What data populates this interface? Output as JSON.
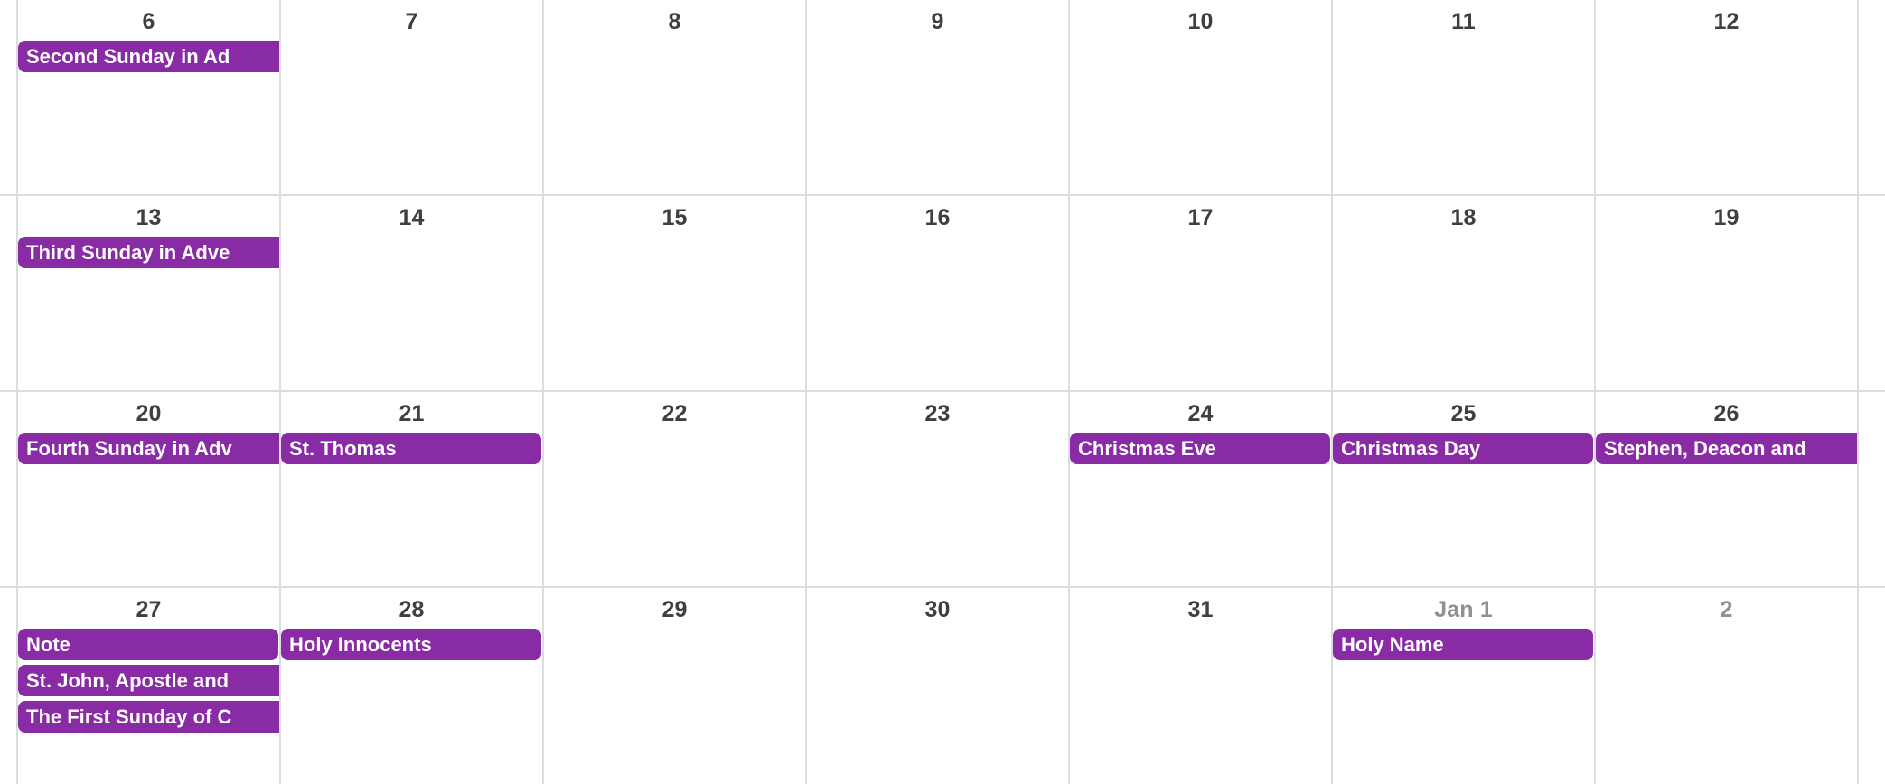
{
  "calendar": {
    "view": "month-grid",
    "accent_color": "#8a2ba6",
    "grid_line_color": "#dadce0",
    "day_number_color": "#3c4043",
    "other_month_day_number_color": "#8d9196",
    "weeks": [
      {
        "days": [
          {
            "number": "6",
            "other_month": false,
            "events": [
              {
                "title": "Second Sunday in Ad",
                "full_title": "Second Sunday in Ad",
                "clipped": true
              }
            ]
          },
          {
            "number": "7",
            "other_month": false,
            "events": []
          },
          {
            "number": "8",
            "other_month": false,
            "events": []
          },
          {
            "number": "9",
            "other_month": false,
            "events": []
          },
          {
            "number": "10",
            "other_month": false,
            "events": []
          },
          {
            "number": "11",
            "other_month": false,
            "events": []
          },
          {
            "number": "12",
            "other_month": false,
            "events": []
          }
        ]
      },
      {
        "days": [
          {
            "number": "13",
            "other_month": false,
            "events": [
              {
                "title": "Third Sunday in Adve",
                "full_title": "Third Sunday in Adve",
                "clipped": true
              }
            ]
          },
          {
            "number": "14",
            "other_month": false,
            "events": []
          },
          {
            "number": "15",
            "other_month": false,
            "events": []
          },
          {
            "number": "16",
            "other_month": false,
            "events": []
          },
          {
            "number": "17",
            "other_month": false,
            "events": []
          },
          {
            "number": "18",
            "other_month": false,
            "events": []
          },
          {
            "number": "19",
            "other_month": false,
            "events": []
          }
        ]
      },
      {
        "days": [
          {
            "number": "20",
            "other_month": false,
            "events": [
              {
                "title": "Fourth Sunday in Adv",
                "full_title": "Fourth Sunday in Adv",
                "clipped": true
              }
            ]
          },
          {
            "number": "21",
            "other_month": false,
            "events": [
              {
                "title": "St. Thomas",
                "full_title": "St. Thomas",
                "clipped": false
              }
            ]
          },
          {
            "number": "22",
            "other_month": false,
            "events": []
          },
          {
            "number": "23",
            "other_month": false,
            "events": []
          },
          {
            "number": "24",
            "other_month": false,
            "events": [
              {
                "title": "Christmas Eve",
                "full_title": "Christmas Eve",
                "clipped": false
              }
            ]
          },
          {
            "number": "25",
            "other_month": false,
            "events": [
              {
                "title": "Christmas Day",
                "full_title": "Christmas Day",
                "clipped": false
              }
            ]
          },
          {
            "number": "26",
            "other_month": false,
            "events": [
              {
                "title": "Stephen, Deacon and",
                "full_title": "Stephen, Deacon and",
                "clipped": true
              }
            ]
          }
        ]
      },
      {
        "days": [
          {
            "number": "27",
            "other_month": false,
            "events": [
              {
                "title": "Note",
                "full_title": "Note",
                "clipped": false
              },
              {
                "title": "St. John, Apostle and",
                "full_title": "St. John, Apostle and",
                "clipped": true
              },
              {
                "title": "The First Sunday of C",
                "full_title": "The First Sunday of C",
                "clipped": true
              }
            ]
          },
          {
            "number": "28",
            "other_month": false,
            "events": [
              {
                "title": "Holy Innocents",
                "full_title": "Holy Innocents",
                "clipped": false
              }
            ]
          },
          {
            "number": "29",
            "other_month": false,
            "events": []
          },
          {
            "number": "30",
            "other_month": false,
            "events": []
          },
          {
            "number": "31",
            "other_month": false,
            "events": []
          },
          {
            "number": "Jan 1",
            "other_month": true,
            "events": [
              {
                "title": "Holy Name",
                "full_title": "Holy Name",
                "clipped": false
              }
            ]
          },
          {
            "number": "2",
            "other_month": true,
            "events": []
          }
        ]
      }
    ]
  }
}
